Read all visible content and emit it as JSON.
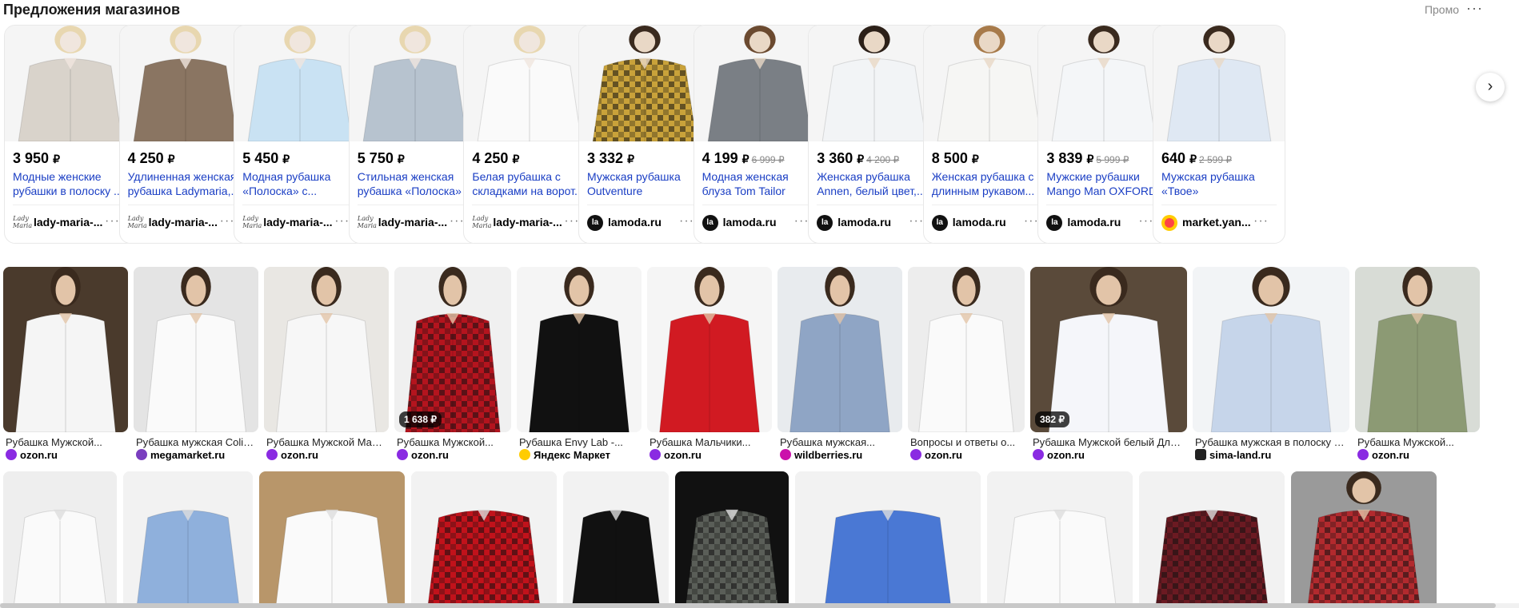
{
  "header": {
    "title": "Предложения магазинов",
    "promo": "Промо",
    "menu": "···"
  },
  "offers": [
    {
      "price": "3 950",
      "old": "",
      "name": "Модные женские рубашки в полоску ...",
      "shop": "lady-maria-...",
      "logo": "lady",
      "shirt": "#d9d3cb",
      "body": "#f0e6de",
      "hair": "#e8d7b0"
    },
    {
      "price": "4 250",
      "old": "",
      "name": "Удлиненная женская рубашка Ladymaria,...",
      "shop": "lady-maria-...",
      "logo": "lady",
      "shirt": "#8a7562",
      "body": "#f0e6de",
      "hair": "#e8d7b0"
    },
    {
      "price": "5 450",
      "old": "",
      "name": "Модная рубашка «Полоска» с...",
      "shop": "lady-maria-...",
      "logo": "lady",
      "shirt": "#c9e2f3",
      "body": "#f0e6de",
      "hair": "#e8d7b0"
    },
    {
      "price": "5 750",
      "old": "",
      "name": "Стильная женская рубашка «Полоска» ...",
      "shop": "lady-maria-...",
      "logo": "lady",
      "shirt": "#b7c3cf",
      "body": "#f0e6de",
      "hair": "#e8d7b0"
    },
    {
      "price": "4 250",
      "old": "",
      "name": "Белая рубашка с складками на ворот...",
      "shop": "lady-maria-...",
      "logo": "lady",
      "shirt": "#fafafa",
      "body": "#f0e6de",
      "hair": "#e8d7b0"
    },
    {
      "price": "3 332",
      "old": "",
      "name": "Мужская рубашка Outventure",
      "shop": "lamoda.ru",
      "logo": "lamoda",
      "shirt": "#c9a23a",
      "body": "#e9d8c6",
      "hair": "#3a2a1e"
    },
    {
      "price": "4 199",
      "old": "6 999",
      "name": "Модная женская блуза Tom Tailor",
      "shop": "lamoda.ru",
      "logo": "lamoda",
      "shirt": "#7a7f85",
      "body": "#e9d8c6",
      "hair": "#6b4a30"
    },
    {
      "price": "3 360",
      "old": "4 200",
      "name": "Женская рубашка Annen, белый цвет,...",
      "shop": "lamoda.ru",
      "logo": "lamoda",
      "shirt": "#f2f4f6",
      "body": "#e9d8c6",
      "hair": "#2c2018"
    },
    {
      "price": "8 500",
      "old": "",
      "name": "Женская рубашка с длинным рукавом...",
      "shop": "lamoda.ru",
      "logo": "lamoda",
      "shirt": "#f6f6f4",
      "body": "#e9d8c6",
      "hair": "#a77a4a"
    },
    {
      "price": "3 839",
      "old": "5 999",
      "name": "Мужские рубашки Mango Man OXFORD",
      "shop": "lamoda.ru",
      "logo": "lamoda",
      "shirt": "#f4f6f8",
      "body": "#e9d8c6",
      "hair": "#3a2a1e"
    },
    {
      "price": "640",
      "old": "2 599",
      "name": "Мужская рубашка «Твое»",
      "shop": "market.yan...",
      "logo": "market",
      "shirt": "#dfe8f3",
      "body": "#e9d8c6",
      "hair": "#3a2a1e"
    }
  ],
  "next_icon": "chevron-right-icon",
  "grid1": [
    {
      "cap": "Рубашка Мужской...",
      "src": "ozon.ru",
      "icon": "ozon",
      "w": 130,
      "bg": "#4a3a2c",
      "shirt": "#f5f5f5",
      "badge": ""
    },
    {
      "cap": "Рубашка мужская Colin's...",
      "src": "megamarket.ru",
      "icon": "mega",
      "w": 130,
      "bg": "#e4e4e4",
      "shirt": "#fafafa",
      "badge": ""
    },
    {
      "cap": "Рубашка Мужской Марс...",
      "src": "ozon.ru",
      "icon": "ozon",
      "w": 130,
      "bg": "#e9e7e3",
      "shirt": "#f7f7f7",
      "badge": ""
    },
    {
      "cap": "Рубашка Мужской...",
      "src": "ozon.ru",
      "icon": "ozon",
      "w": 120,
      "bg": "#f0f0f0",
      "shirt": "#b4141e",
      "badge": "1 638 ₽"
    },
    {
      "cap": "Рубашка Envy Lab -...",
      "src": "Яндекс Маркет",
      "icon": "yandex",
      "w": 130,
      "bg": "#f5f5f5",
      "shirt": "#111111",
      "badge": ""
    },
    {
      "cap": "Рубашка Мальчики...",
      "src": "ozon.ru",
      "icon": "ozon",
      "w": 130,
      "bg": "#f5f5f5",
      "shirt": "#d11a22",
      "badge": ""
    },
    {
      "cap": "Рубашка мужская...",
      "src": "wildberries.ru",
      "icon": "wb",
      "w": 130,
      "bg": "#e8ebee",
      "shirt": "#8fa5c5",
      "badge": ""
    },
    {
      "cap": "Вопросы и ответы о...",
      "src": "ozon.ru",
      "icon": "ozon",
      "w": 120,
      "bg": "#ededed",
      "shirt": "#fafafa",
      "badge": ""
    },
    {
      "cap": "Рубашка Мужской белый Длинны...",
      "src": "ozon.ru",
      "icon": "ozon",
      "w": 170,
      "bg": "#5a4a3a",
      "shirt": "#f5f6fa",
      "badge": "382 ₽"
    },
    {
      "cap": "Рубашка мужская в полоску Reno,...",
      "src": "sima-land.ru",
      "icon": "sima",
      "w": 170,
      "bg": "#f2f4f6",
      "shirt": "#c6d5ea",
      "badge": ""
    },
    {
      "cap": "Рубашка Мужской...",
      "src": "ozon.ru",
      "icon": "ozon",
      "w": 130,
      "bg": "#d8dcd6",
      "shirt": "#8c9a74",
      "badge": ""
    }
  ],
  "grid2": [
    {
      "w": 120,
      "bg": "#eeeeee",
      "shirt": "#fafafa"
    },
    {
      "w": 140,
      "bg": "#f2f2f2",
      "shirt": "#8fb0dc"
    },
    {
      "w": 160,
      "bg": "#b8966a",
      "shirt": "#fafafa"
    },
    {
      "w": 160,
      "bg": "#f2f2f2",
      "shirt": "#c1121b"
    },
    {
      "w": 110,
      "bg": "#f2f2f2",
      "shirt": "#111111"
    },
    {
      "w": 120,
      "bg": "#111111",
      "shirt": "#5a5e58"
    },
    {
      "w": 210,
      "bg": "#f2f2f2",
      "shirt": "#4a78d4"
    },
    {
      "w": 160,
      "bg": "#f2f2f2",
      "shirt": "#fafafa"
    },
    {
      "w": 160,
      "bg": "#f2f2f2",
      "shirt": "#6b1a22"
    },
    {
      "w": 160,
      "bg": "#9a9a9a",
      "shirt": "#b22a2e"
    }
  ]
}
